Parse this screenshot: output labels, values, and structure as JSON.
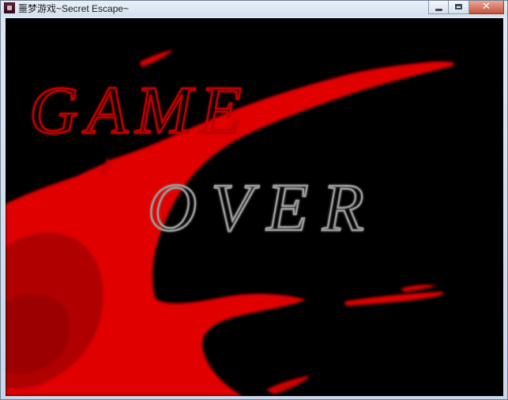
{
  "window": {
    "title": "噩梦游戏~Secret Escape~",
    "app_icon": "game-app-icon",
    "controls": {
      "minimize_icon": "minimize-icon",
      "maximize_icon": "maximize-icon",
      "close_icon": "close-icon",
      "close_glyph": "✕"
    }
  },
  "game_screen": {
    "headline_top": "GAME",
    "headline_bottom": "OVER",
    "colors": {
      "background": "#000000",
      "blood": "#e00000",
      "blood_dark": "#b00000",
      "game_text": "#c00000",
      "over_text": "#9a9a9a"
    }
  }
}
